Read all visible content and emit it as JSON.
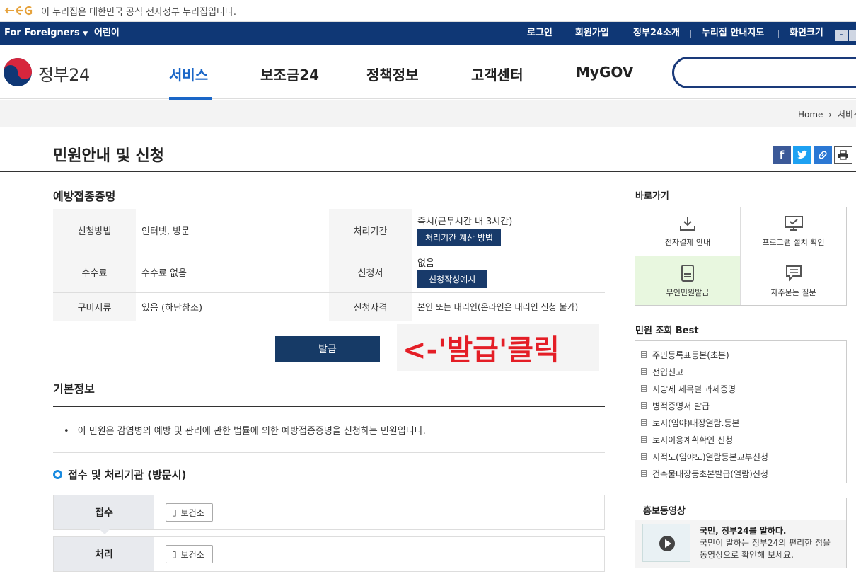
{
  "banner": {
    "text": "이 누리집은 대한민국 공식 전자정부 누리집입니다."
  },
  "topbar": {
    "foreigners": "For Foreigners",
    "kids": "어린이",
    "links": [
      "로그인",
      "회원가입",
      "정부24소개",
      "누리집 안내지도",
      "화면크기"
    ],
    "zoom_minus": "-"
  },
  "header": {
    "logo_text": "정부24",
    "nav": [
      "서비스",
      "보조금24",
      "정책정보",
      "고객센터",
      "MyGOV"
    ]
  },
  "breadcrumb": {
    "home": "Home",
    "current": "서비스"
  },
  "page": {
    "title": "민원안내 및 신청"
  },
  "service": {
    "name": "예방접종증명",
    "rows": [
      {
        "h1": "신청방법",
        "v1": "인터넷, 방문",
        "h2": "처리기간",
        "v2": "즉시(근무시간 내 3시간)",
        "btn": "처리기간 계산 방법"
      },
      {
        "h1": "수수료",
        "v1": "수수료 없음",
        "h2": "신청서",
        "v2": "없음",
        "btn": "신청작성예시"
      },
      {
        "h1": "구비서류",
        "v1": "있음 (하단참조)",
        "h2": "신청자격",
        "v2": "본인 또는 대리인(온라인은 대리인 신청 불가)"
      }
    ],
    "issue_button": "발급",
    "annotation": "<-'발급'클릭"
  },
  "basic": {
    "title": "기본정보",
    "text": "이 민원은 감염병의 예방 및 관리에 관한 법률에 의한 예방접종증명을 신청하는 민원입니다."
  },
  "process": {
    "title": "접수 및 처리기관 (방문시)",
    "rows": [
      {
        "label": "접수",
        "chip": "보건소"
      },
      {
        "label": "처리",
        "chip": "보건소"
      }
    ]
  },
  "sidebar": {
    "quick_title": "바로가기",
    "quick": [
      "전자결제 안내",
      "프로그램 설치 확인",
      "무인민원발급",
      "자주묻는 질문"
    ],
    "best_title": "민원 조회 Best",
    "best": [
      "주민등록표등본(초본)",
      "전입신고",
      "지방세 세목별 과세증명",
      "병적증명서 발급",
      "토지(임야)대장열람.등본",
      "토지이용계획확인 신청",
      "지적도(임야도)열람등본교부신청",
      "건축물대장등초본발급(열람)신청"
    ],
    "promo_title": "홍보동영상",
    "promo_heading": "국민, 정부24를 말하다.",
    "promo_desc": "국민이 말하는 정부24의 편리한 점을 동영상으로 확인해 보세요."
  },
  "colors": {
    "navy": "#0f3775",
    "accent": "#1a66c7",
    "annotation": "#e41e26",
    "quick_highlight": "#e8f7df"
  }
}
